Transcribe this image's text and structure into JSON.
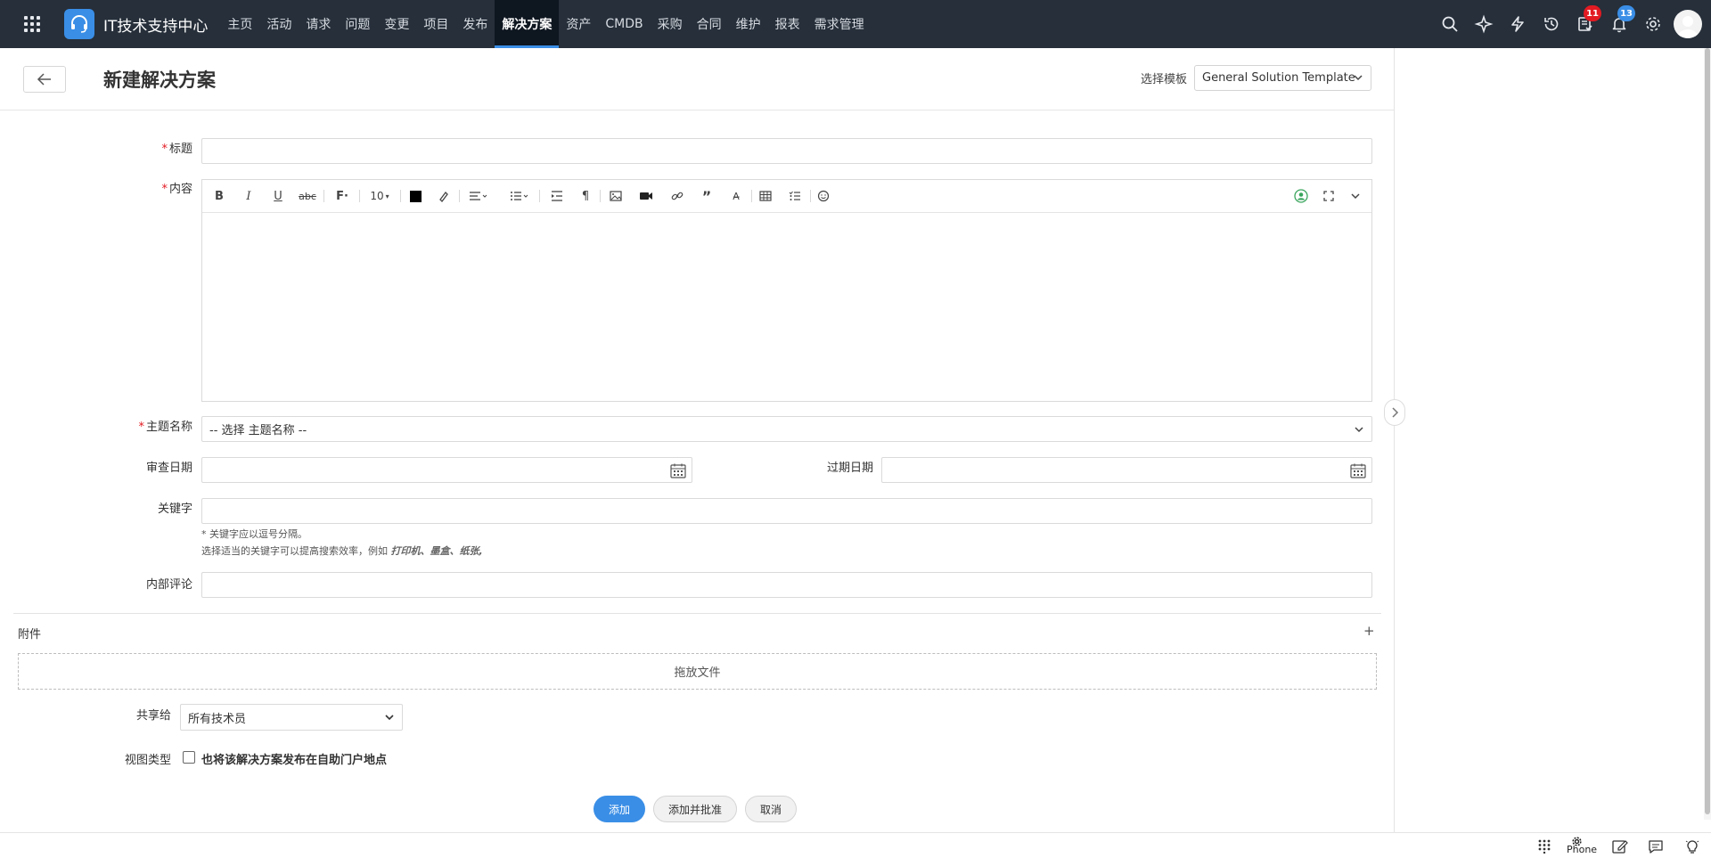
{
  "app": {
    "title": "IT技术支持中心",
    "nav": [
      "主页",
      "活动",
      "请求",
      "问题",
      "变更",
      "项目",
      "发布",
      "解决方案",
      "资产",
      "CMDB",
      "采购",
      "合同",
      "维护",
      "报表",
      "需求管理"
    ],
    "active_nav_index": 7,
    "icons": [
      "search-icon",
      "ai-sparkle-icon",
      "lightning-icon",
      "history-icon",
      "task-icon",
      "bell-icon",
      "gear-icon"
    ],
    "badges": {
      "tasks": "11",
      "notifications": "13"
    },
    "colors": {
      "topbar": "#262f3a",
      "accent": "#3a8ee6",
      "badge_red": "#e21a22"
    }
  },
  "page": {
    "title": "新建解决方案",
    "template_label": "选择模板",
    "template_value": "General Solution Template"
  },
  "form": {
    "title_label": "标题",
    "content_label": "内容",
    "font_size": "10",
    "topic_label": "主题名称",
    "topic_placeholder": "-- 选择 主题名称 --",
    "review_date_label": "审查日期",
    "expiry_date_label": "过期日期",
    "keywords_label": "关键字",
    "keywords_hint1": "* 关键字应以逗号分隔。",
    "keywords_hint2_prefix": "选择适当的关键字可以提高搜索效率，例如",
    "keywords_hint2_example": "打印机、墨盒、纸张,",
    "comment_label": "内部评论",
    "attachments_label": "附件",
    "attachments_add": "+",
    "dropzone_text": "拖放文件",
    "share_label": "共享给",
    "share_value": "所有技术员",
    "view_type_label": "视图类型",
    "publish_checkbox_label": "也将该解决方案发布在自助门户地点"
  },
  "buttons": {
    "add": "添加",
    "add_approve": "添加并批准",
    "cancel": "取消"
  },
  "bottom_bar": {
    "phone_label": "Phone"
  }
}
